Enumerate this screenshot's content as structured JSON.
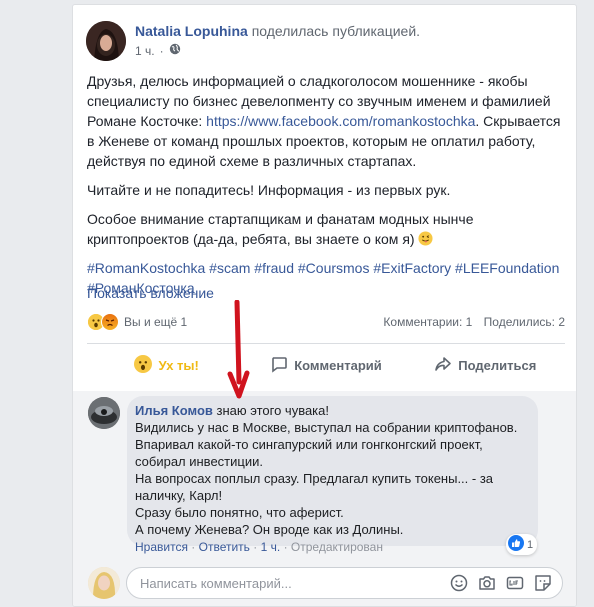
{
  "post": {
    "author": "Natalia Lopuhina",
    "shared_text": "поделилась публикацией.",
    "time": "1 ч.",
    "privacy_icon": "globe-icon",
    "paragraph1_prefix": "Друзья, делюсь информацией о сладкоголосом мошеннике - якобы специалисту по бизнес девелопменту со звучным именем и фамилией Романе Косточке: ",
    "paragraph1_link": "https://www.facebook.com/romankostochka",
    "paragraph1_suffix": ". Скрывается в Женеве от команд прошлых проектов, которым не оплатил работу, действуя по единой схеме в различных стартапах.",
    "paragraph2": "Читайте и не попадитесь! Информация - из первых рук.",
    "paragraph3": "Особое внимание стартапщикам и фанатам модных нынче криптопроектов (да-да, ребята, вы знаете о ком я)",
    "tags": "#RomanKostochka #scam #fraud #Coursmos #ExitFactory #LEEFoundation #РоманКосточка",
    "show_attachment": "Показать вложение"
  },
  "stats": {
    "reactions_text": "Вы и ещё 1",
    "comments": "Комментарии: 1",
    "shares": "Поделились: 2"
  },
  "actions": {
    "wow": "Ух ты!",
    "comment": "Комментарий",
    "share": "Поделиться"
  },
  "comment": {
    "author": "Илья Комов",
    "lines": [
      "знаю этого чувака!",
      "Видились у нас в Москве, выступал на собрании криптофанов.",
      "Впаривал какой-то сингапурский или гонгконгский проект, собирал инвестиции.",
      "На вопросах поплыл сразу. Предлагал купить токены... - за наличку, Карл!",
      "Сразу было понятно, что аферист.",
      "А почему Женева? Он вроде как из Долины."
    ],
    "likes": "1",
    "like_action": "Нравится",
    "reply_action": "Ответить",
    "time": "1 ч.",
    "edited": "Отредактирован"
  },
  "composer": {
    "placeholder": "Написать комментарий..."
  },
  "colors": {
    "link": "#385898",
    "wow_active": "#f0ba15",
    "arrow": "#d0131e"
  }
}
